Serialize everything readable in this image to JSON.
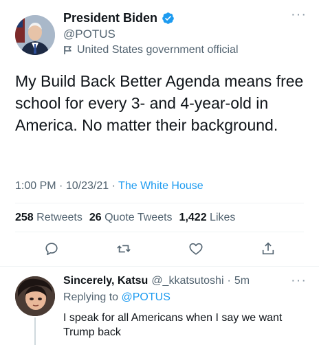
{
  "tweet": {
    "display_name": "President Biden",
    "handle": "@POTUS",
    "account_label": "United States government official",
    "text": "My Build Back Better Agenda means free school for every 3- and 4-year-old in America. No matter their background.",
    "time": "1:00 PM",
    "date": "10/23/21",
    "dot": "·",
    "source": "The White House",
    "more": "···"
  },
  "stats": {
    "retweets_count": "258",
    "retweets_label": "Retweets",
    "quotes_count": "26",
    "quotes_label": "Quote Tweets",
    "likes_count": "1,422",
    "likes_label": "Likes"
  },
  "actions": {
    "icons": [
      "reply-icon",
      "retweet-icon",
      "like-icon",
      "share-icon"
    ]
  },
  "reply": {
    "display_name": "Sincerely, Katsu",
    "handle": "@_kkatsutoshi",
    "dot": "·",
    "time": "5m",
    "replying_prefix": "Replying to",
    "replying_to": "@POTUS",
    "text": "I speak for all Americans when I say we want Trump back",
    "more": "···"
  },
  "colors": {
    "accent": "#1d9bf0",
    "secondary_text": "#536471",
    "primary_text": "#0f1419"
  }
}
